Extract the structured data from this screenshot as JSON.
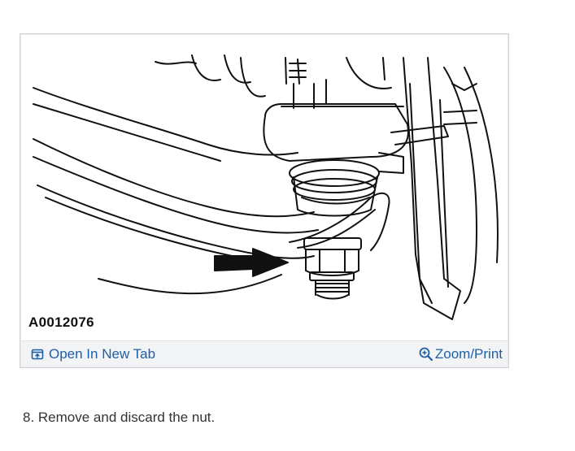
{
  "figure": {
    "id_label": "A0012076"
  },
  "toolbar": {
    "open_tab_label": "Open In New Tab",
    "zoom_print_label": "Zoom/Print",
    "open_tab_icon": "open-in-new-tab-icon",
    "zoom_icon": "magnifier-plus-icon",
    "link_color": "#1f5fa8"
  },
  "instructions": {
    "step": "8. Remove and discard the nut."
  }
}
